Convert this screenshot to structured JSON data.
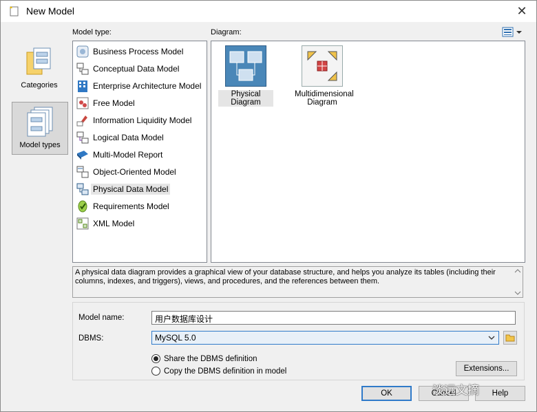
{
  "window": {
    "title": "New Model"
  },
  "categories": [
    {
      "label": "Categories",
      "selected": false
    },
    {
      "label": "Model types",
      "selected": true
    }
  ],
  "model_type_label": "Model type:",
  "diagram_label": "Diagram:",
  "model_types": [
    {
      "label": "Business Process Model",
      "icon": "business-process-icon"
    },
    {
      "label": "Conceptual Data Model",
      "icon": "conceptual-data-icon"
    },
    {
      "label": "Enterprise Architecture Model",
      "icon": "enterprise-architecture-icon"
    },
    {
      "label": "Free Model",
      "icon": "free-model-icon"
    },
    {
      "label": "Information Liquidity Model",
      "icon": "information-liquidity-icon"
    },
    {
      "label": "Logical Data Model",
      "icon": "logical-data-icon"
    },
    {
      "label": "Multi-Model Report",
      "icon": "report-book-icon"
    },
    {
      "label": "Object-Oriented Model",
      "icon": "object-oriented-icon"
    },
    {
      "label": "Physical Data Model",
      "icon": "physical-data-icon",
      "selected": true
    },
    {
      "label": "Requirements Model",
      "icon": "requirements-icon"
    },
    {
      "label": "XML Model",
      "icon": "xml-model-icon"
    }
  ],
  "diagrams": [
    {
      "label": "Physical Diagram",
      "icon": "physical-diagram-icon",
      "selected": true
    },
    {
      "label": "Multidimensional Diagram",
      "icon": "multidimensional-diagram-icon"
    }
  ],
  "description": "A physical data diagram provides a graphical view of your database structure, and helps you analyze its tables (including their columns, indexes, and triggers), views, and procedures, and the references between them.",
  "form": {
    "model_name_label": "Model name:",
    "model_name_value": "用户数据库设计",
    "dbms_label": "DBMS:",
    "dbms_value": "MySQL 5.0",
    "radio_share": "Share the DBMS definition",
    "radio_copy": "Copy the DBMS definition in model",
    "radio_selected": "share"
  },
  "buttons": {
    "extensions": "Extensions...",
    "ok": "OK",
    "cancel": "Cancel",
    "help": "Help"
  },
  "watermark": "淡远文摘"
}
